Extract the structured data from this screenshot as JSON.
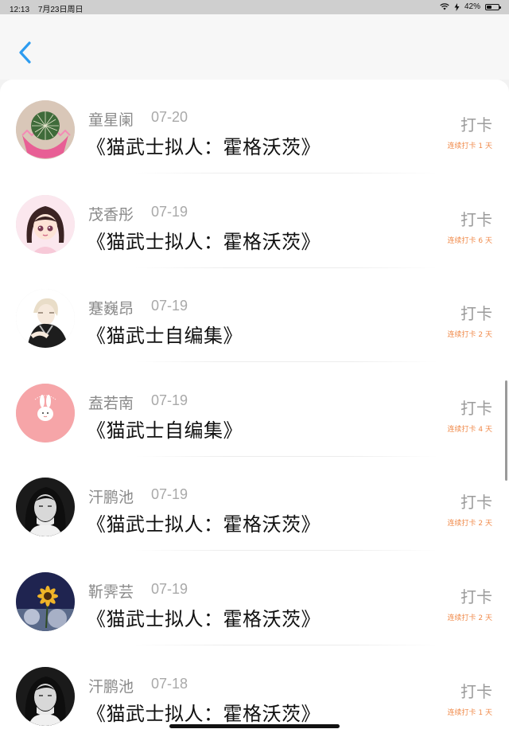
{
  "status_bar": {
    "time": "12:13",
    "date": "7月23日周日",
    "battery": "42%",
    "battery_level": 0.42,
    "wifi_icon": "wifi-icon",
    "charging_icon": "charging-icon"
  },
  "nav": {
    "back_icon": "chevron-left-icon",
    "accent": "#2d9cf0"
  },
  "colors": {
    "streak": "#f08a4a",
    "checkin": "#9b9b9b"
  },
  "entries": [
    {
      "name": "童星阑",
      "date": "07-20",
      "book": "《猫武士拟人：霍格沃茨》",
      "action": "打卡",
      "streak": "连续打卡 1 天",
      "avatar": "cactus"
    },
    {
      "name": "茂香彤",
      "date": "07-19",
      "book": "《猫武士拟人：霍格沃茨》",
      "action": "打卡",
      "streak": "连续打卡 6 天",
      "avatar": "anime-girl"
    },
    {
      "name": "蹇巍昂",
      "date": "07-19",
      "book": "《猫武士自编集》",
      "action": "打卡",
      "streak": "连续打卡 2 天",
      "avatar": "anime-boy"
    },
    {
      "name": "盍若南",
      "date": "07-19",
      "book": "《猫武士自编集》",
      "action": "打卡",
      "streak": "连续打卡 4 天",
      "avatar": "pink-rabbit"
    },
    {
      "name": "汗鹏池",
      "date": "07-19",
      "book": "《猫武士拟人：霍格沃茨》",
      "action": "打卡",
      "streak": "连续打卡 2 天",
      "avatar": "bw-girl"
    },
    {
      "name": "靳霁芸",
      "date": "07-19",
      "book": "《猫武士拟人：霍格沃茨》",
      "action": "打卡",
      "streak": "连续打卡 2 天",
      "avatar": "sunflower"
    },
    {
      "name": "汗鹏池",
      "date": "07-18",
      "book": "《猫武士拟人：霍格沃茨》",
      "action": "打卡",
      "streak": "连续打卡 1 天",
      "avatar": "bw-girl"
    }
  ]
}
